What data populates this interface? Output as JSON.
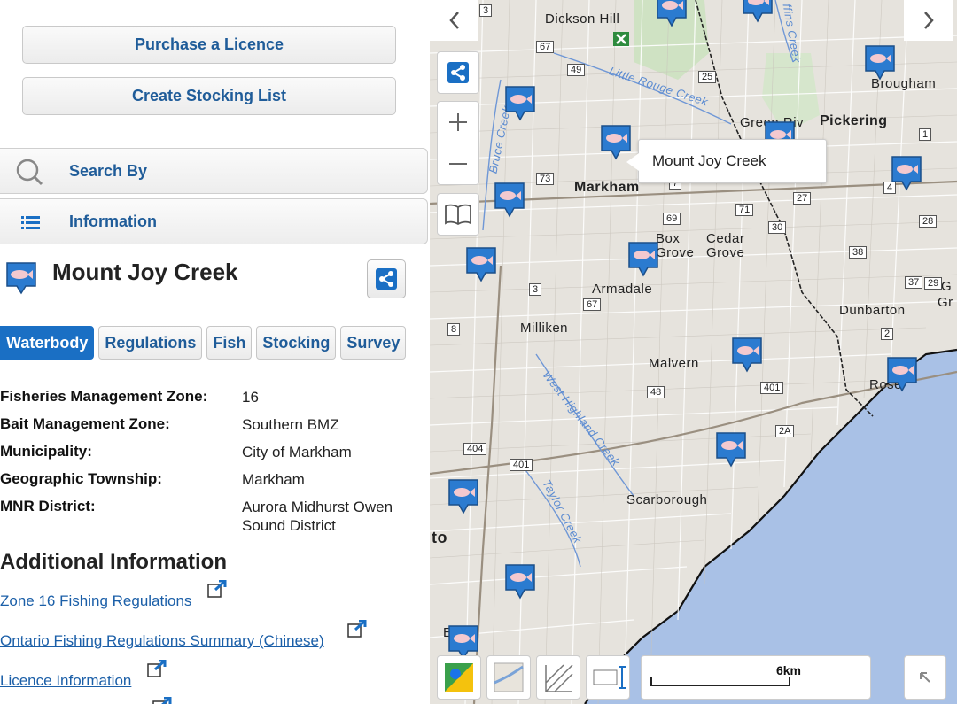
{
  "panel": {
    "purchase_label": "Purchase a Licence",
    "stocking_label": "Create Stocking List",
    "search_label": "Search By",
    "information_label": "Information",
    "waterbody_title": "Mount Joy Creek",
    "tabs": [
      {
        "label": "Waterbody",
        "active": true
      },
      {
        "label": "Regulations"
      },
      {
        "label": "Fish"
      },
      {
        "label": "Stocking"
      },
      {
        "label": "Survey"
      }
    ],
    "info": [
      {
        "key": "Fisheries Management Zone:",
        "value": "16"
      },
      {
        "key": "Bait Management Zone:",
        "value": "Southern BMZ"
      },
      {
        "key": "Municipality:",
        "value": "City of Markham"
      },
      {
        "key": "Geographic Township:",
        "value": "Markham"
      },
      {
        "key": "MNR District:",
        "value": "Aurora Midhurst Owen Sound District"
      }
    ],
    "additional_heading": "Additional Information",
    "links": [
      "Zone 16 Fishing Regulations",
      "Ontario Fishing Regulations Summary (Chinese)",
      "Licence Information"
    ]
  },
  "map": {
    "tooltip": "Mount Joy Creek",
    "scale_label": "6km",
    "places": {
      "dickson_hill": "Dickson Hill",
      "brougham": "Brougham",
      "pickering": "Pickering",
      "green_river": "Green Riv",
      "markham": "Markham",
      "box_grove": "Box Grove",
      "cedar_grove": "Cedar Grove",
      "armadale": "Armadale",
      "dunbarton": "Dunbarton",
      "milliken": "Milliken",
      "malvern": "Malvern",
      "rose": "Rose",
      "scarborough": "Scarborough",
      "to": "to",
      "york": "E   ork",
      "g": "G",
      "gr": "Gr"
    },
    "creeks": {
      "little_rouge": "Little Rouge Creek",
      "bruce": "Bruce Creek",
      "west_highland": "West Highland Creek",
      "taylor": "Taylor Creek",
      "duffins": "ffins Creek"
    },
    "highways": [
      "3",
      "67",
      "49",
      "25",
      "1",
      "73",
      "7",
      "71",
      "27",
      "4",
      "69",
      "28",
      "30",
      "38",
      "3",
      "67",
      "37",
      "29",
      "8",
      "2",
      "48",
      "401",
      "2A",
      "404",
      "401"
    ],
    "colors": {
      "water": "#a9c1e6",
      "land": "#e6e3dd",
      "road": "#ffffff",
      "primary_blue": "#1a6fc4"
    }
  }
}
